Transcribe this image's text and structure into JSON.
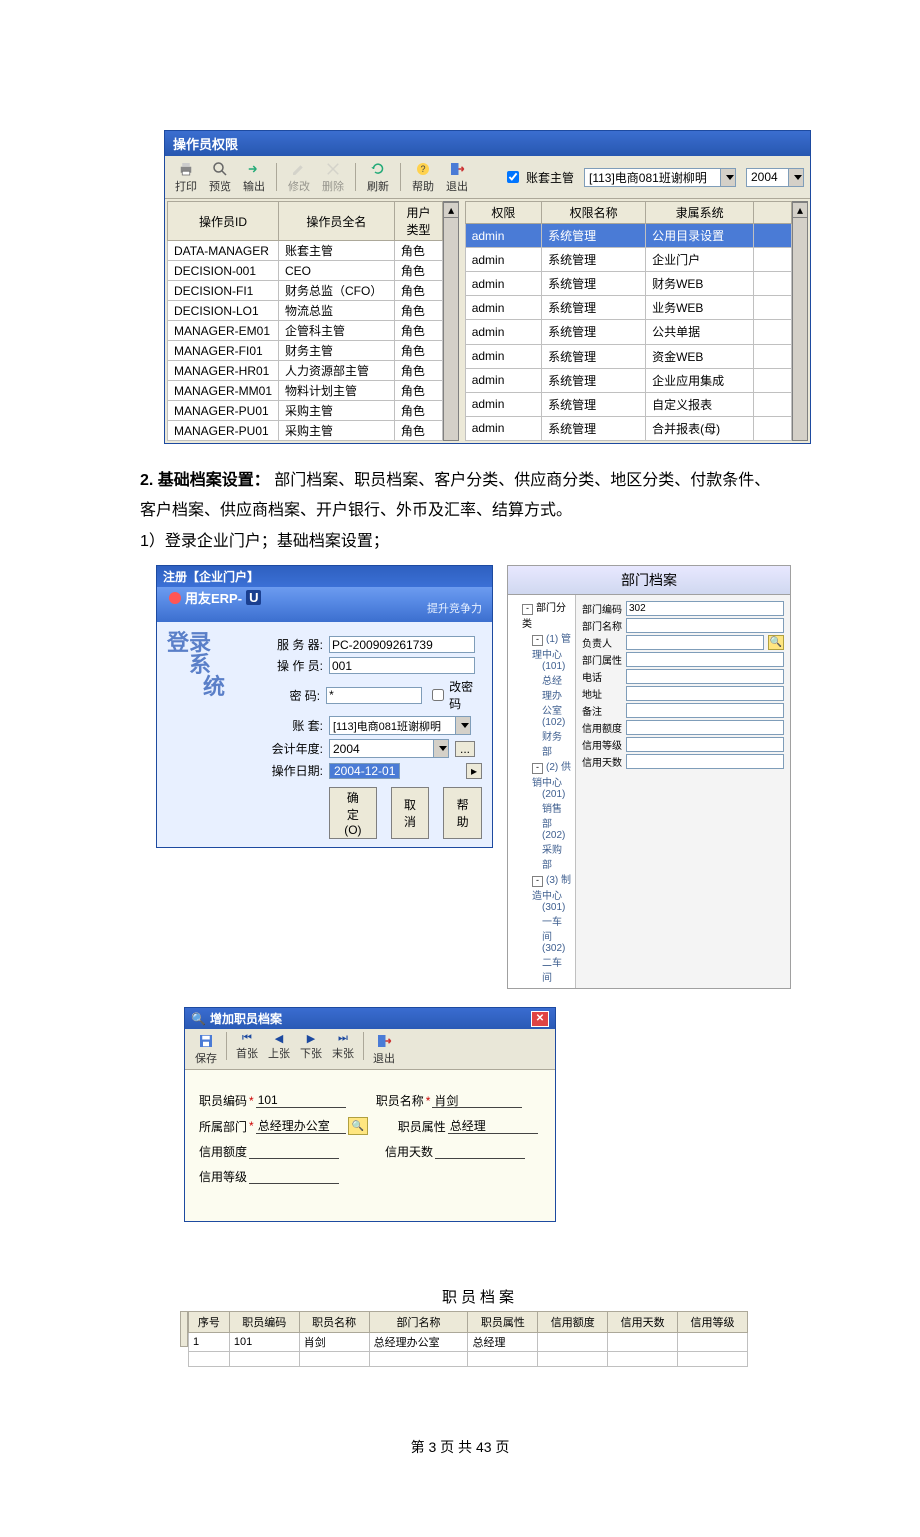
{
  "permWindow": {
    "title": "操作员权限",
    "toolbar": {
      "print": "打印",
      "preview": "预览",
      "export": "输出",
      "modify": "修改",
      "delete": "删除",
      "refresh": "刷新",
      "help": "帮助",
      "exit": "退出"
    },
    "accountOwnerCheckLabel": "账套主管",
    "accountSelect": "[113]电商081班谢柳明",
    "yearSelect": "2004",
    "leftTable": {
      "headers": {
        "id": "操作员ID",
        "name": "操作员全名",
        "type": "用户类型"
      },
      "rows": [
        {
          "id": "DATA-MANAGER",
          "name": "账套主管",
          "type": "角色"
        },
        {
          "id": "DECISION-001",
          "name": "CEO",
          "type": "角色"
        },
        {
          "id": "DECISION-FI1",
          "name": "财务总监（CFO）",
          "type": "角色"
        },
        {
          "id": "DECISION-LO1",
          "name": "物流总监",
          "type": "角色"
        },
        {
          "id": "MANAGER-EM01",
          "name": "企管科主管",
          "type": "角色"
        },
        {
          "id": "MANAGER-FI01",
          "name": "财务主管",
          "type": "角色"
        },
        {
          "id": "MANAGER-HR01",
          "name": "人力资源部主管",
          "type": "角色"
        },
        {
          "id": "MANAGER-MM01",
          "name": "物料计划主管",
          "type": "角色"
        },
        {
          "id": "MANAGER-PU01",
          "name": "采购主管",
          "type": "角色"
        },
        {
          "id": "MANAGER-PU01",
          "name": "采购主管",
          "type": "角色"
        }
      ]
    },
    "rightTable": {
      "headers": {
        "perm": "权限",
        "permName": "权限名称",
        "system": "隶属系统"
      },
      "rows": [
        {
          "perm": "admin",
          "permName": "系统管理",
          "system": "公用目录设置",
          "selected": true
        },
        {
          "perm": "admin",
          "permName": "系统管理",
          "system": "企业门户"
        },
        {
          "perm": "admin",
          "permName": "系统管理",
          "system": "财务WEB"
        },
        {
          "perm": "admin",
          "permName": "系统管理",
          "system": "业务WEB"
        },
        {
          "perm": "admin",
          "permName": "系统管理",
          "system": "公共单据"
        },
        {
          "perm": "admin",
          "permName": "系统管理",
          "system": "资金WEB"
        },
        {
          "perm": "admin",
          "permName": "系统管理",
          "system": "企业应用集成"
        },
        {
          "perm": "admin",
          "permName": "系统管理",
          "system": "自定义报表"
        },
        {
          "perm": "admin",
          "permName": "系统管理",
          "system": "合并报表(母)"
        }
      ]
    }
  },
  "bodyText": {
    "heading": "2. 基础档案设置：",
    "rest1": "部门档案、职员档案、客户分类、供应商分类、地区分类、付款条件、客户档案、供应商档案、开户银行、外币及汇率、结算方式。",
    "line2": "1）登录企业门户；基础档案设置；"
  },
  "login": {
    "windowTitle": "注册【企业门户】",
    "logo": "用友ERP-",
    "logoSuffix": "U",
    "slogan": "提升竞争力",
    "artLines": [
      "登录",
      "系",
      "统"
    ],
    "labels": {
      "server": "服 务 器:",
      "operator": "操 作 员:",
      "password": "密    码:",
      "changePwd": "改密码",
      "account": "账    套:",
      "year": "会计年度:",
      "opDate": "操作日期:"
    },
    "values": {
      "server": "PC-200909261739",
      "operator": "001",
      "password": "*",
      "account": "[113]电商081班谢柳明",
      "year": "2004",
      "opDate": "2004-12-01"
    },
    "buttons": {
      "ok": "确定(O)",
      "cancel": "取消",
      "help": "帮助"
    }
  },
  "dept": {
    "title": "部门档案",
    "tree": {
      "root": "部门分类",
      "groups": [
        {
          "code": "(1)",
          "name": "管理中心",
          "children": [
            {
              "code": "(101)",
              "name": "总经理办公室"
            },
            {
              "code": "(102)",
              "name": "财务部"
            }
          ]
        },
        {
          "code": "(2)",
          "name": "供销中心",
          "children": [
            {
              "code": "(201)",
              "name": "销售部"
            },
            {
              "code": "(202)",
              "name": "采购部"
            }
          ]
        },
        {
          "code": "(3)",
          "name": "制造中心",
          "children": [
            {
              "code": "(301)",
              "name": "一车间"
            },
            {
              "code": "(302)",
              "name": "二车间"
            }
          ]
        }
      ]
    },
    "fields": {
      "code": "部门编码",
      "codeVal": "302",
      "name": "部门名称",
      "head": "负责人",
      "attr": "部门属性",
      "phone": "电话",
      "addr": "地址",
      "note": "备注",
      "creditAmt": "信用额度",
      "creditLvl": "信用等级",
      "creditDays": "信用天数"
    }
  },
  "addEmp": {
    "title": "增加职员档案",
    "toolbar": {
      "save": "保存",
      "first": "首张",
      "prev": "上张",
      "next": "下张",
      "last": "末张",
      "exit": "退出"
    },
    "labels": {
      "code": "职员编码",
      "name": "职员名称",
      "dept": "所属部门",
      "attr": "职员属性",
      "creditAmt": "信用额度",
      "creditDays": "信用天数",
      "creditLvl": "信用等级"
    },
    "values": {
      "code": "101",
      "name": "肖剑",
      "dept": "总经理办公室",
      "attr": "总经理"
    }
  },
  "empList": {
    "title": "职员档案",
    "headers": {
      "no": "序号",
      "code": "职员编码",
      "name": "职员名称",
      "dept": "部门名称",
      "attr": "职员属性",
      "creditAmt": "信用额度",
      "creditDays": "信用天数",
      "creditLvl": "信用等级"
    },
    "rows": [
      {
        "no": "1",
        "code": "101",
        "name": "肖剑",
        "dept": "总经理办公室",
        "attr": "总经理",
        "creditAmt": "",
        "creditDays": "",
        "creditLvl": ""
      }
    ]
  },
  "footer": "第 3 页 共 43 页"
}
